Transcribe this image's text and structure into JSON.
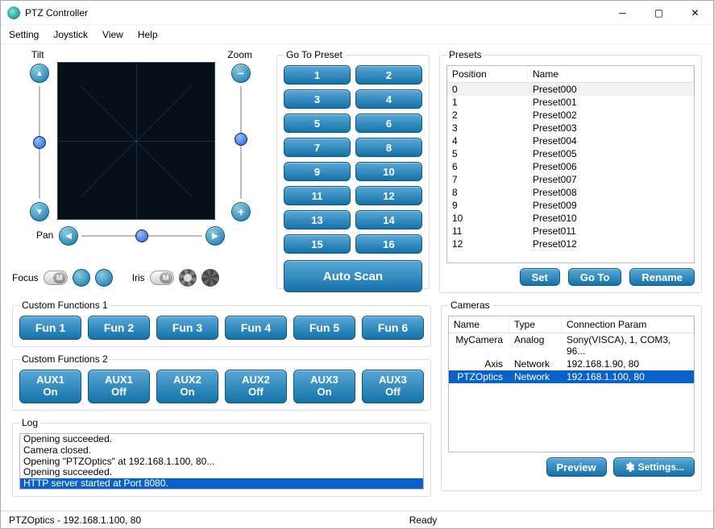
{
  "window": {
    "title": "PTZ Controller"
  },
  "menu": [
    "Setting",
    "Joystick",
    "View",
    "Help"
  ],
  "ptz": {
    "tilt_label": "Tilt",
    "zoom_label": "Zoom",
    "pan_label": "Pan",
    "focus_label": "Focus",
    "iris_label": "Iris",
    "manual_badge": "M"
  },
  "goToPreset": {
    "legend": "Go To Preset",
    "buttons": [
      "1",
      "2",
      "3",
      "4",
      "5",
      "6",
      "7",
      "8",
      "9",
      "10",
      "11",
      "12",
      "13",
      "14",
      "15",
      "16"
    ],
    "autoscan": "Auto Scan"
  },
  "presets": {
    "legend": "Presets",
    "colPosition": "Position",
    "colName": "Name",
    "rows": [
      {
        "pos": "0",
        "name": "Preset000"
      },
      {
        "pos": "1",
        "name": "Preset001"
      },
      {
        "pos": "2",
        "name": "Preset002"
      },
      {
        "pos": "3",
        "name": "Preset003"
      },
      {
        "pos": "4",
        "name": "Preset004"
      },
      {
        "pos": "5",
        "name": "Preset005"
      },
      {
        "pos": "6",
        "name": "Preset006"
      },
      {
        "pos": "7",
        "name": "Preset007"
      },
      {
        "pos": "8",
        "name": "Preset008"
      },
      {
        "pos": "9",
        "name": "Preset009"
      },
      {
        "pos": "10",
        "name": "Preset010"
      },
      {
        "pos": "11",
        "name": "Preset011"
      },
      {
        "pos": "12",
        "name": "Preset012"
      }
    ],
    "set": "Set",
    "goto": "Go To",
    "rename": "Rename"
  },
  "custom1": {
    "legend": "Custom Functions 1",
    "buttons": [
      "Fun 1",
      "Fun 2",
      "Fun 3",
      "Fun 4",
      "Fun 5",
      "Fun 6"
    ]
  },
  "custom2": {
    "legend": "Custom Functions 2",
    "buttons": [
      "AUX1\nOn",
      "AUX1\nOff",
      "AUX2\nOn",
      "AUX2\nOff",
      "AUX3\nOn",
      "AUX3\nOff"
    ]
  },
  "cameras": {
    "legend": "Cameras",
    "colName": "Name",
    "colType": "Type",
    "colConn": "Connection Param",
    "rows": [
      {
        "name": "MyCamera",
        "type": "Analog",
        "conn": "Sony(VISCA), 1, COM3, 96...",
        "sel": false
      },
      {
        "name": "Axis",
        "type": "Network",
        "conn": "192.168.1.90, 80",
        "sel": false
      },
      {
        "name": "PTZOptics",
        "type": "Network",
        "conn": "192.168.1.100, 80",
        "sel": true
      }
    ],
    "preview": "Preview",
    "settings": "Settings..."
  },
  "log": {
    "legend": "Log",
    "lines": [
      {
        "t": "Opening succeeded.",
        "sel": false
      },
      {
        "t": "Camera closed.",
        "sel": false
      },
      {
        "t": "Opening \"PTZOptics\" at 192.168.1.100, 80...",
        "sel": false
      },
      {
        "t": "Opening succeeded.",
        "sel": false
      },
      {
        "t": "HTTP server started at Port 8080.",
        "sel": true
      }
    ]
  },
  "status": {
    "left": "PTZOptics - 192.168.1.100, 80",
    "center": "Ready"
  }
}
